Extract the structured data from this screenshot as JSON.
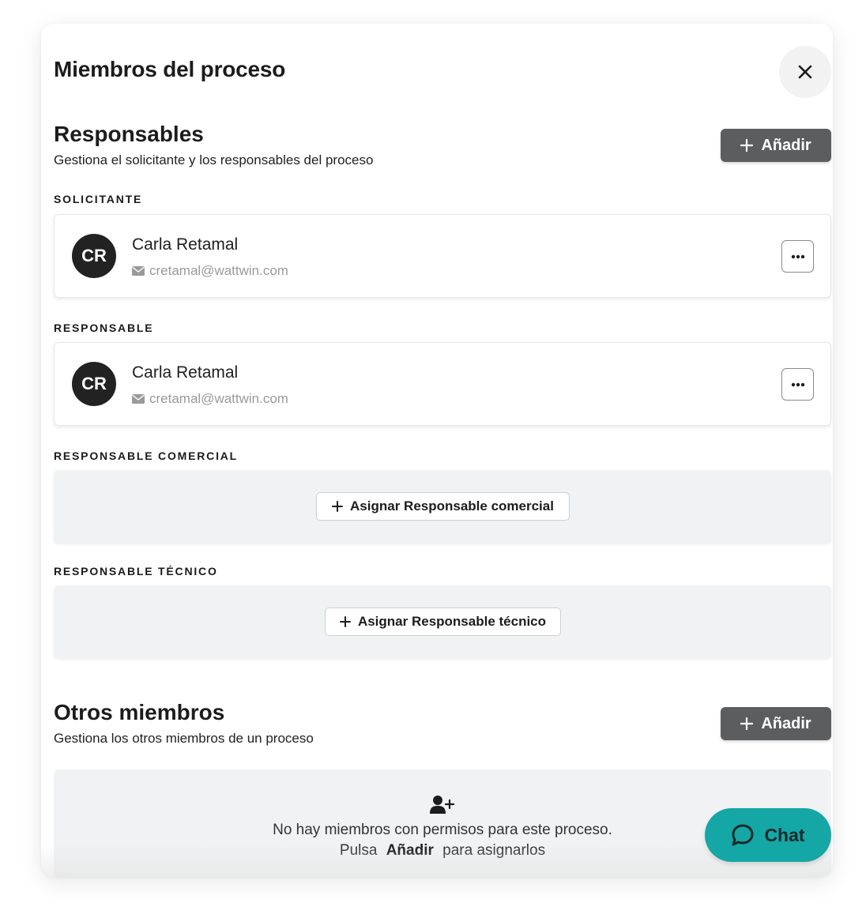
{
  "modal": {
    "title": "Miembros del proceso"
  },
  "responsables": {
    "title": "Responsables",
    "subtitle": "Gestiona el solicitante y los responsables del proceso",
    "add_label": "Añadir",
    "solicitante": {
      "label": "SOLICITANTE",
      "initials": "CR",
      "name": "Carla Retamal",
      "email": "cretamal@wattwin.com"
    },
    "responsable": {
      "label": "RESPONSABLE",
      "initials": "CR",
      "name": "Carla Retamal",
      "email": "cretamal@wattwin.com"
    },
    "comercial": {
      "label": "RESPONSABLE COMERCIAL",
      "assign_label": "Asignar Responsable comercial"
    },
    "tecnico": {
      "label": "RESPONSABLE TÉCNICO",
      "assign_label": "Asignar Responsable técnico"
    }
  },
  "otros": {
    "title": "Otros miembros",
    "subtitle": "Gestiona los otros miembros de un proceso",
    "add_label": "Añadir",
    "empty_line1": "No hay miembros con permisos para este proceso.",
    "empty_prefix": "Pulsa",
    "empty_bold": "Añadir",
    "empty_suffix": "para asignarlos"
  },
  "chat": {
    "label": "Chat"
  },
  "colors": {
    "primary_button": "#5b5d5f",
    "chat": "#14a7a5",
    "avatar": "#222222",
    "empty_bg": "#f1f2f3"
  }
}
